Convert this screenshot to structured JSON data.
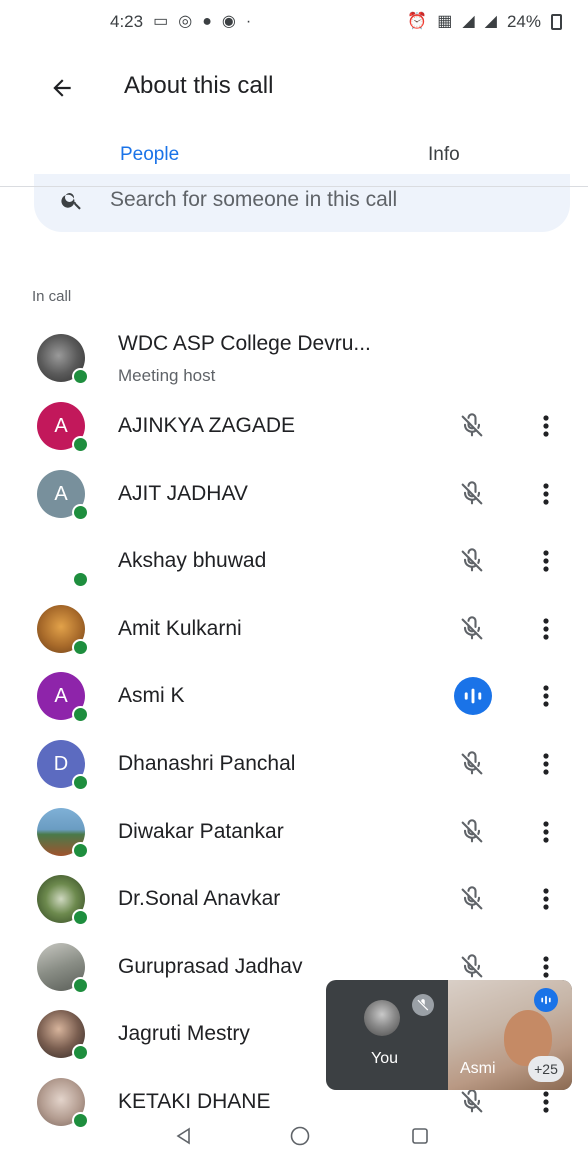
{
  "status_bar": {
    "time": "4:23",
    "battery": "24%"
  },
  "header": {
    "title": "About this call"
  },
  "tabs": [
    {
      "label": "People"
    },
    {
      "label": "Info"
    }
  ],
  "search": {
    "placeholder": "Search for someone in this call"
  },
  "section": {
    "label": "In call"
  },
  "host": {
    "name": "WDC ASP College Devru...",
    "role": "Meeting host"
  },
  "participants": [
    {
      "name": "AJINKYA ZAGADE",
      "initial": "A",
      "avatar_color": "#c2185b",
      "mic": "muted"
    },
    {
      "name": "AJIT JADHAV",
      "initial": "A",
      "avatar_color": "#78909c",
      "mic": "muted"
    },
    {
      "name": "Akshay bhuwad",
      "initial": "",
      "avatar_color": "#ffffff",
      "mic": "muted"
    },
    {
      "name": "Amit Kulkarni",
      "initial": "",
      "avatar_color": "#b07a3a",
      "mic": "muted"
    },
    {
      "name": "Asmi K",
      "initial": "A",
      "avatar_color": "#8e24aa",
      "mic": "speaking"
    },
    {
      "name": "Dhanashri Panchal",
      "initial": "D",
      "avatar_color": "#5c6bc0",
      "mic": "muted"
    },
    {
      "name": "Diwakar Patankar",
      "initial": "",
      "avatar_color": "#5b8fb3",
      "mic": "muted"
    },
    {
      "name": "Dr.Sonal Anavkar",
      "initial": "",
      "avatar_color": "#4e6b3a",
      "mic": "muted"
    },
    {
      "name": "Guruprasad Jadhav",
      "initial": "",
      "avatar_color": "#8d8f8a",
      "mic": "muted"
    },
    {
      "name": "Jagruti Mestry",
      "initial": "",
      "avatar_color": "#6b5a55",
      "mic": "hidden"
    },
    {
      "name": "KETAKI DHANE",
      "initial": "",
      "avatar_color": "#a89890",
      "mic": "muted"
    }
  ],
  "pip": {
    "self_label": "You",
    "other_label": "Asmi",
    "more_count": "+25"
  },
  "colors": {
    "accent": "#1a73e8",
    "online": "#1e8e3e",
    "muted_icon": "#5f6368"
  }
}
